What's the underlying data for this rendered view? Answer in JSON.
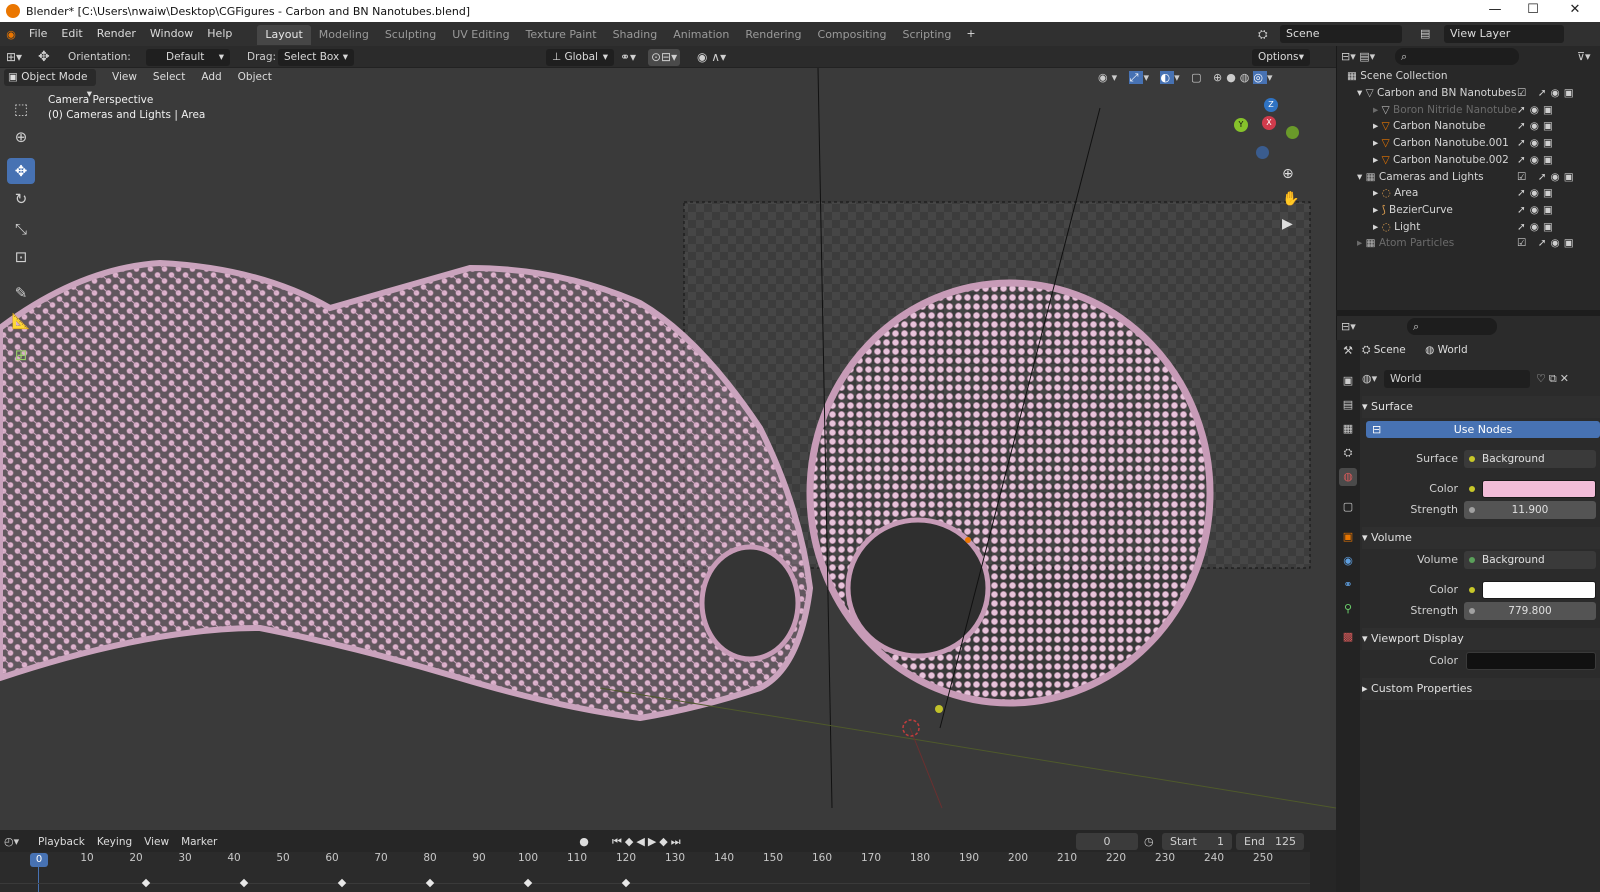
{
  "window": {
    "title": "Blender* [C:\\Users\\nwaiw\\Desktop\\CGFigures - Carbon and BN Nanotubes.blend]",
    "minimize": "—",
    "maximize": "☐",
    "close": "✕"
  },
  "menu": {
    "items": [
      "File",
      "Edit",
      "Render",
      "Window",
      "Help"
    ],
    "workspaces": [
      "Layout",
      "Modeling",
      "Sculpting",
      "UV Editing",
      "Texture Paint",
      "Shading",
      "Animation",
      "Rendering",
      "Compositing",
      "Scripting"
    ],
    "active_workspace": "Layout",
    "add_tab": "+",
    "scene_label": "Scene",
    "view_layer_label": "View Layer"
  },
  "tool_settings": {
    "orientation_label": "Orientation:",
    "orientation_value": "Default",
    "drag_label": "Drag:",
    "drag_value": "Select Box",
    "transform_space": "Global",
    "options": "Options"
  },
  "viewport_header": {
    "mode": "Object Mode",
    "menus": [
      "View",
      "Select",
      "Add",
      "Object"
    ]
  },
  "viewport": {
    "camera_label": "Camera Perspective",
    "context_label": "(0) Cameras and Lights | Area",
    "gizmo": {
      "x": "X",
      "y": "Y",
      "z": "Z"
    },
    "nanotube_color": "#e2bcd4",
    "background_color": "#3a3a3a"
  },
  "tools": [
    "select-box",
    "cursor",
    "move",
    "rotate",
    "scale",
    "transform",
    "annotate",
    "measure",
    "add-cube"
  ],
  "outliner": {
    "root": "Scene Collection",
    "rows": [
      {
        "label": "Carbon and BN Nanotubes",
        "level": 0,
        "dim": false
      },
      {
        "label": "Boron Nitride Nanotube",
        "level": 1,
        "dim": true
      },
      {
        "label": "Carbon Nanotube",
        "level": 1,
        "dim": false
      },
      {
        "label": "Carbon Nanotube.001",
        "level": 1,
        "dim": false
      },
      {
        "label": "Carbon Nanotube.002",
        "level": 1,
        "dim": false
      },
      {
        "label": "Cameras and Lights",
        "level": 0,
        "dim": false
      },
      {
        "label": "Area",
        "level": 1,
        "dim": false
      },
      {
        "label": "BezierCurve",
        "level": 1,
        "dim": false
      },
      {
        "label": "Light",
        "level": 1,
        "dim": false
      },
      {
        "label": "Atom Particles",
        "level": 0,
        "dim": true
      }
    ]
  },
  "properties": {
    "breadcrumb_scene": "Scene",
    "breadcrumb_world": "World",
    "world_name": "World",
    "surface_section": "Surface",
    "use_nodes": "Use Nodes",
    "surface_label": "Surface",
    "surface_value": "Background",
    "color_label": "Color",
    "surface_color": "#f2bcd8",
    "strength_label": "Strength",
    "surface_strength": "11.900",
    "volume_section": "Volume",
    "volume_label": "Volume",
    "volume_value": "Background",
    "volume_color": "#ffffff",
    "volume_strength": "779.800",
    "viewport_display_section": "Viewport Display",
    "viewport_color": "#111111",
    "custom_props_section": "Custom Properties"
  },
  "timeline": {
    "menus": [
      "Playback",
      "Keying",
      "View",
      "Marker"
    ],
    "current_frame": "0",
    "start_label": "Start",
    "start": "1",
    "end_label": "End",
    "end": "125",
    "frame_indicator": "0",
    "ticks": [
      "10",
      "20",
      "30",
      "40",
      "50",
      "60",
      "70",
      "80",
      "90",
      "100",
      "110",
      "120",
      "130",
      "140",
      "150",
      "160",
      "170",
      "180",
      "190",
      "200",
      "210",
      "220",
      "230",
      "240",
      "250"
    ],
    "keyframes": [
      22,
      42,
      62,
      80,
      100,
      120
    ]
  }
}
